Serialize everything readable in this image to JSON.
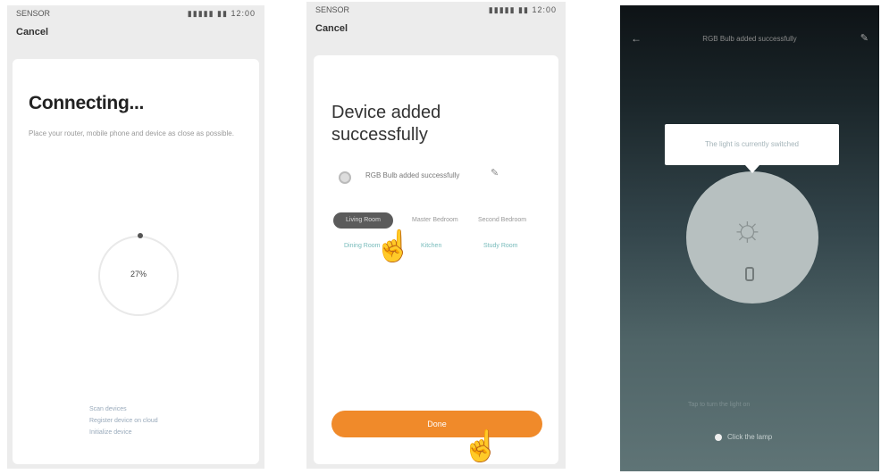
{
  "screen1": {
    "status_left": "SENSOR",
    "status_right": "▮▮▮▮▮ ▮▮ 12:00",
    "cancel": "Cancel",
    "title": "Connecting...",
    "subtitle": "Place your router, mobile phone and device as close as possible.",
    "progress_percent": "27%",
    "tips": [
      "Scan devices",
      "Register device on cloud",
      "Initialize device"
    ]
  },
  "screen2": {
    "status_left": "SENSOR",
    "status_right": "▮▮▮▮▮ ▮▮ 12:00",
    "cancel": "Cancel",
    "title": "Device added successfully",
    "device_name": "RGB Bulb added successfully",
    "rooms": [
      "Living Room",
      "Master Bedroom",
      "Second Bedroom",
      "Dining Room",
      "Kitchen",
      "Study Room"
    ],
    "selected_room": "Living Room",
    "done_label": "Done"
  },
  "screen3": {
    "status_left": "",
    "status_right": "",
    "nav_title": "RGB Bulb added successfully",
    "tooltip": "The light is currently switched",
    "hint": "Tap to turn the light on",
    "power_label": "Click the lamp"
  }
}
